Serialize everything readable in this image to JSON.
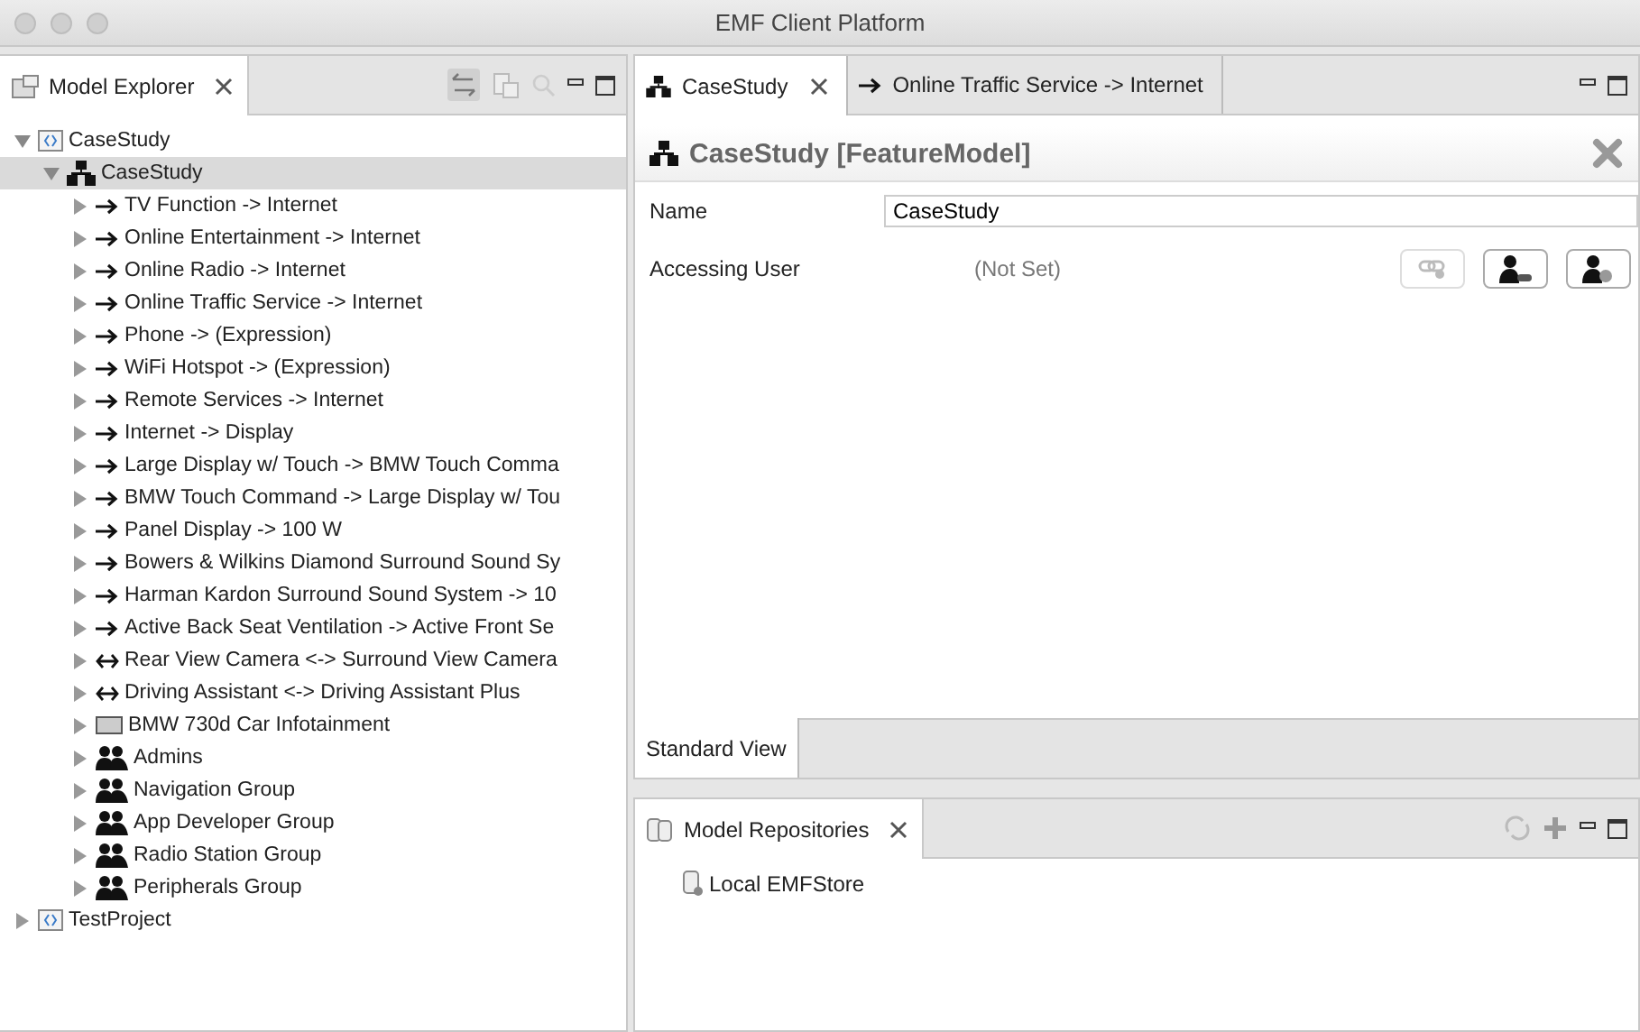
{
  "window": {
    "title": "EMF Client Platform"
  },
  "model_explorer": {
    "tab": {
      "label": "Model Explorer",
      "selected": true
    },
    "tree": [
      {
        "label": "CaseStudy",
        "kind": "project",
        "expanded": true,
        "selected": false,
        "children": [
          {
            "label": "CaseStudy",
            "kind": "featuremodel",
            "expanded": true,
            "selected": true,
            "children": [
              {
                "label": "TV Function -> Internet",
                "kind": "arrow",
                "expanded": false,
                "selected": false
              },
              {
                "label": "Online Entertainment -> Internet",
                "kind": "arrow",
                "expanded": false,
                "selected": false
              },
              {
                "label": "Online Radio -> Internet",
                "kind": "arrow",
                "expanded": false,
                "selected": false
              },
              {
                "label": "Online Traffic Service -> Internet",
                "kind": "arrow",
                "expanded": false,
                "selected": false
              },
              {
                "label": "Phone -> (Expression)",
                "kind": "arrow",
                "expanded": false,
                "selected": false
              },
              {
                "label": "WiFi Hotspot -> (Expression)",
                "kind": "arrow",
                "expanded": false,
                "selected": false
              },
              {
                "label": "Remote Services -> Internet",
                "kind": "arrow",
                "expanded": false,
                "selected": false
              },
              {
                "label": "Internet -> Display",
                "kind": "arrow",
                "expanded": false,
                "selected": false
              },
              {
                "label": "Large Display w/ Touch -> BMW Touch Comma",
                "kind": "arrow",
                "expanded": false,
                "selected": false
              },
              {
                "label": "BMW Touch Command -> Large Display w/ Tou",
                "kind": "arrow",
                "expanded": false,
                "selected": false
              },
              {
                "label": "Panel Display -> 100 W",
                "kind": "arrow",
                "expanded": false,
                "selected": false
              },
              {
                "label": "Bowers & Wilkins Diamond Surround Sound Sy",
                "kind": "arrow",
                "expanded": false,
                "selected": false
              },
              {
                "label": "Harman Kardon Surround Sound System -> 10",
                "kind": "arrow",
                "expanded": false,
                "selected": false
              },
              {
                "label": "Active Back Seat Ventilation -> Active Front Se",
                "kind": "arrow",
                "expanded": false,
                "selected": false
              },
              {
                "label": "Rear View Camera <-> Surround View Camera",
                "kind": "biarrow",
                "expanded": false,
                "selected": false
              },
              {
                "label": "Driving Assistant <-> Driving Assistant Plus",
                "kind": "biarrow",
                "expanded": false,
                "selected": false
              },
              {
                "label": "BMW 730d Car Infotainment",
                "kind": "device",
                "expanded": false,
                "selected": false
              },
              {
                "label": "Admins",
                "kind": "group",
                "expanded": false,
                "selected": false
              },
              {
                "label": "Navigation Group",
                "kind": "group",
                "expanded": false,
                "selected": false
              },
              {
                "label": "App Developer Group",
                "kind": "group",
                "expanded": false,
                "selected": false
              },
              {
                "label": "Radio Station Group",
                "kind": "group",
                "expanded": false,
                "selected": false
              },
              {
                "label": "Peripherals Group",
                "kind": "group",
                "expanded": false,
                "selected": false
              }
            ]
          }
        ]
      },
      {
        "label": "TestProject",
        "kind": "project",
        "expanded": false,
        "selected": false
      }
    ]
  },
  "editor": {
    "tabs": [
      {
        "label": "CaseStudy",
        "kind": "featuremodel",
        "selected": true
      },
      {
        "label": "Online Traffic Service -> Internet",
        "kind": "arrow",
        "selected": false
      }
    ],
    "heading": "CaseStudy [FeatureModel]",
    "fields": [
      {
        "label": "Name",
        "value": "CaseStudy"
      }
    ],
    "references": [
      {
        "label": "Accessing User",
        "value": "(Not Set)"
      }
    ],
    "bottom_tab": "Standard View"
  },
  "model_repositories": {
    "tab": "Model Repositories",
    "items": [
      "Local EMFStore"
    ]
  }
}
